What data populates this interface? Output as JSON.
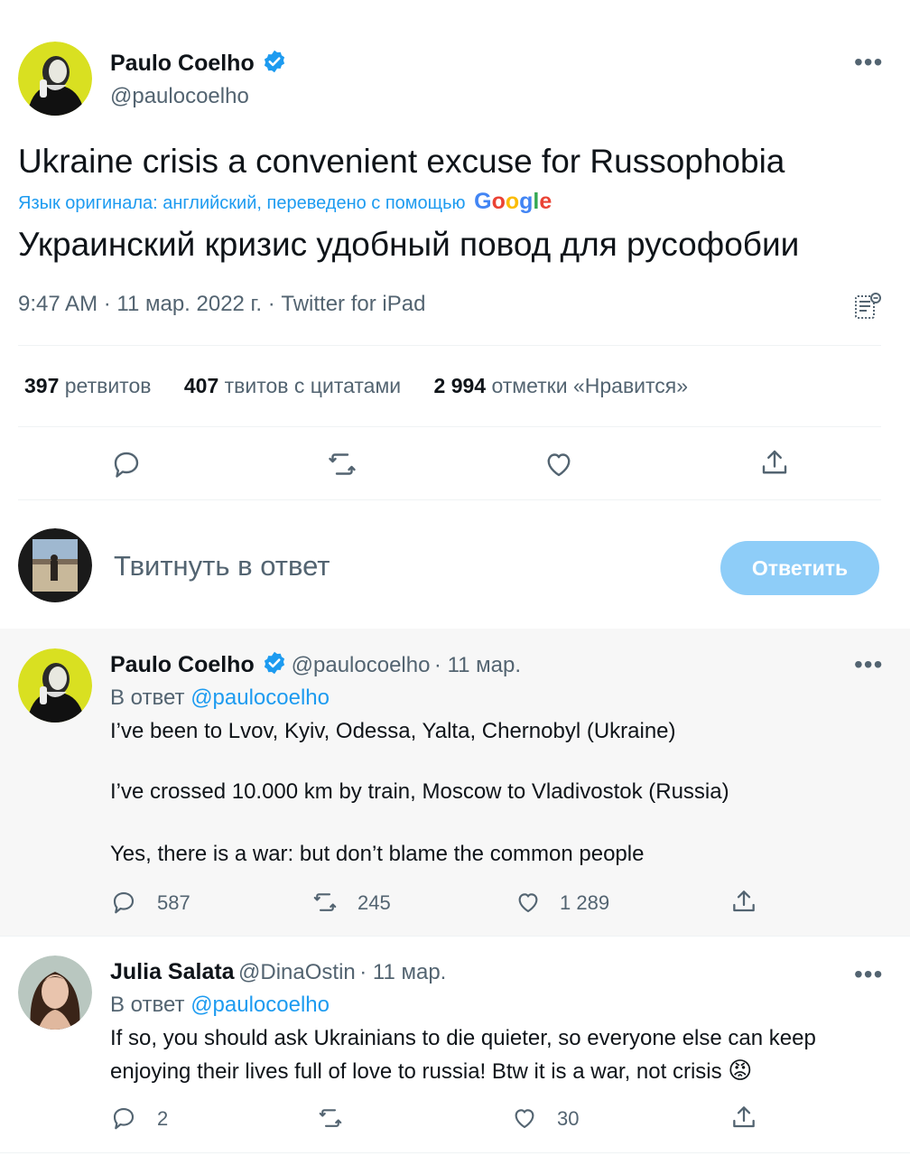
{
  "main_tweet": {
    "author_name": "Paulo Coelho",
    "author_handle": "@paulocoelho",
    "text_original": "Ukraine crisis a convenient excuse for Russophobia",
    "translation_note": "Язык оригинала: английский, переведено с помощью",
    "translation_provider": "Google",
    "text_translated": "Украинский кризис удобный повод для русофобии",
    "timestamp": "9:47 AM · 11 мар. 2022 г. · Twitter for iPad",
    "stats": {
      "retweets_count": "397",
      "retweets_label": "ретвитов",
      "quotes_count": "407",
      "quotes_label": "твитов с цитатами",
      "likes_count": "2 994",
      "likes_label": "отметки «Нравится»"
    }
  },
  "reply_composer": {
    "placeholder": "Твитнуть в ответ",
    "button_label": "Ответить"
  },
  "replies": [
    {
      "author_name": "Paulo Coelho",
      "author_handle": "@paulocoelho",
      "date": "· 11 мар.",
      "replying_prefix": "В ответ",
      "replying_to": "@paulocoelho",
      "lines": [
        "I’ve been to Lvov, Kyiv, Odessa, Yalta, Chernobyl (Ukraine)",
        "I’ve crossed 10.000 km by train, Moscow to Vladivostok (Russia)",
        "Yes, there is a war: but don’t blame the common people"
      ],
      "reply_count": "587",
      "retweet_count": "245",
      "like_count": "1 289"
    },
    {
      "author_name": "Julia Salata",
      "author_handle": "@DinaOstin",
      "date": "· 11 мар.",
      "replying_prefix": "В ответ",
      "replying_to": "@paulocoelho",
      "lines": [
        "If so, you should ask Ukrainians to die quieter, so everyone else can keep",
        "enjoying their lives full of love to russia! Btw it is a war, not crisis"
      ],
      "emoji": "😡",
      "reply_count": "2",
      "retweet_count": "",
      "like_count": "30"
    }
  ],
  "colors": {
    "accent": "#1d9bf0",
    "button_disabled": "#8ecdf8",
    "text_secondary": "#536471",
    "highlight_bg": "#f7f7f7"
  }
}
